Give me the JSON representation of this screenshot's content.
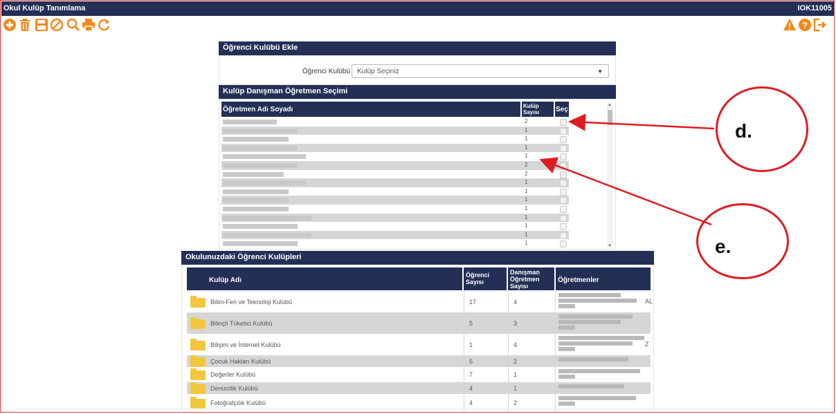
{
  "window": {
    "title": "Okul Kulüp Tanımlama",
    "code": "IOK11005"
  },
  "toolbar": {
    "left_icons": [
      "add-icon",
      "delete-icon",
      "save-icon",
      "cancel-icon",
      "search-icon",
      "print-icon",
      "refresh-icon"
    ],
    "right_icons": [
      "warning-icon",
      "help-icon",
      "exit-icon"
    ],
    "accent": "#f08a1c"
  },
  "add_panel": {
    "title": "Öğrenci Kulübü Ekle",
    "club_label": "Öğrenci Kulübü",
    "club_value": "Kulüp Seçiniz"
  },
  "teacher_panel": {
    "title": "Kulüp Danışman Öğretmen Seçimi",
    "col_name": "Öğretmen Adı Soyadı",
    "col_count_1": "Kulüp",
    "col_count_2": "Sayısı",
    "col_select": "Seç",
    "counts": [
      "2",
      "1",
      "1",
      "1",
      "1",
      "2",
      "2",
      "1",
      "1",
      "1",
      "1",
      "1",
      "1",
      "1",
      "1"
    ]
  },
  "clubs_panel": {
    "title": "Okulunuzdaki Öğrenci Kulüpleri",
    "col_name": "Kulüp Adı",
    "col_students_1": "Öğrenci",
    "col_students_2": "Sayısı",
    "col_advisors_1": "Danışman",
    "col_advisors_2": "Öğretmen",
    "col_advisors_3": "Sayısı",
    "col_teachers": "Öğretmenler",
    "rows": [
      {
        "name": "Bilim-Fen ve Teknoloji Kulübü",
        "students": "17",
        "advisors": "4",
        "suffix": "AL"
      },
      {
        "name": "Bilinçli Tüketici Kulübü",
        "students": "5",
        "advisors": "3",
        "suffix": ""
      },
      {
        "name": "Bilişim ve İnternet Kulübü",
        "students": "1",
        "advisors": "4",
        "suffix": "Z"
      },
      {
        "name": "Çocuk Hakları Kulübü",
        "students": "5",
        "advisors": "2",
        "suffix": ""
      },
      {
        "name": "Değerler Kulübü",
        "students": "7",
        "advisors": "1",
        "suffix": ""
      },
      {
        "name": "Denizcilik Kulübü",
        "students": "4",
        "advisors": "1",
        "suffix": ""
      },
      {
        "name": "Fotoğrafçılık Kulübü",
        "students": "4",
        "advisors": "2",
        "suffix": ""
      }
    ]
  },
  "annotations": {
    "d": {
      "label": "d.",
      "color": "#e01b22"
    },
    "e": {
      "label": "e.",
      "color": "#e01b22"
    }
  }
}
